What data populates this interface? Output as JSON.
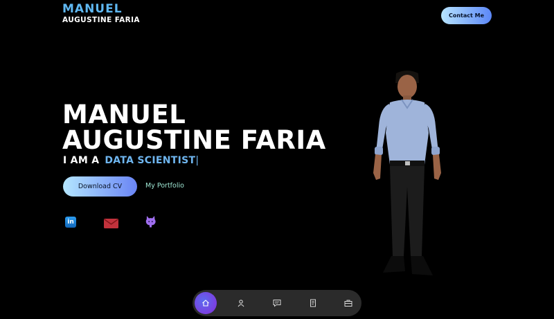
{
  "header": {
    "logo_first": "MANUEL",
    "logo_second": "AUGUSTINE FARIA",
    "contact_label": "Contact Me"
  },
  "hero": {
    "name_line1": "MANUEL",
    "name_line2": "AUGUSTINE FARIA",
    "tagline_prefix": "I AM A",
    "tagline_role": "DATA SCIENTIST",
    "cursor": "|",
    "download_label": "Download CV",
    "portfolio_label": "My Portfolio"
  },
  "social": {
    "linkedin_text": "in",
    "icons": [
      "linkedin-icon",
      "mail-icon",
      "github-icon"
    ]
  },
  "nav": {
    "items": [
      "home-icon",
      "user-icon",
      "chat-icon",
      "document-icon",
      "briefcase-icon"
    ],
    "active": "home-icon"
  },
  "colors": {
    "accent": "#6fb6f0",
    "background": "#000000",
    "nav_bg": "#2b2b2b",
    "button_gradient_start": "#b4e6ff",
    "button_gradient_end": "#6a85f5",
    "active_nav": "#7b3fe0"
  }
}
